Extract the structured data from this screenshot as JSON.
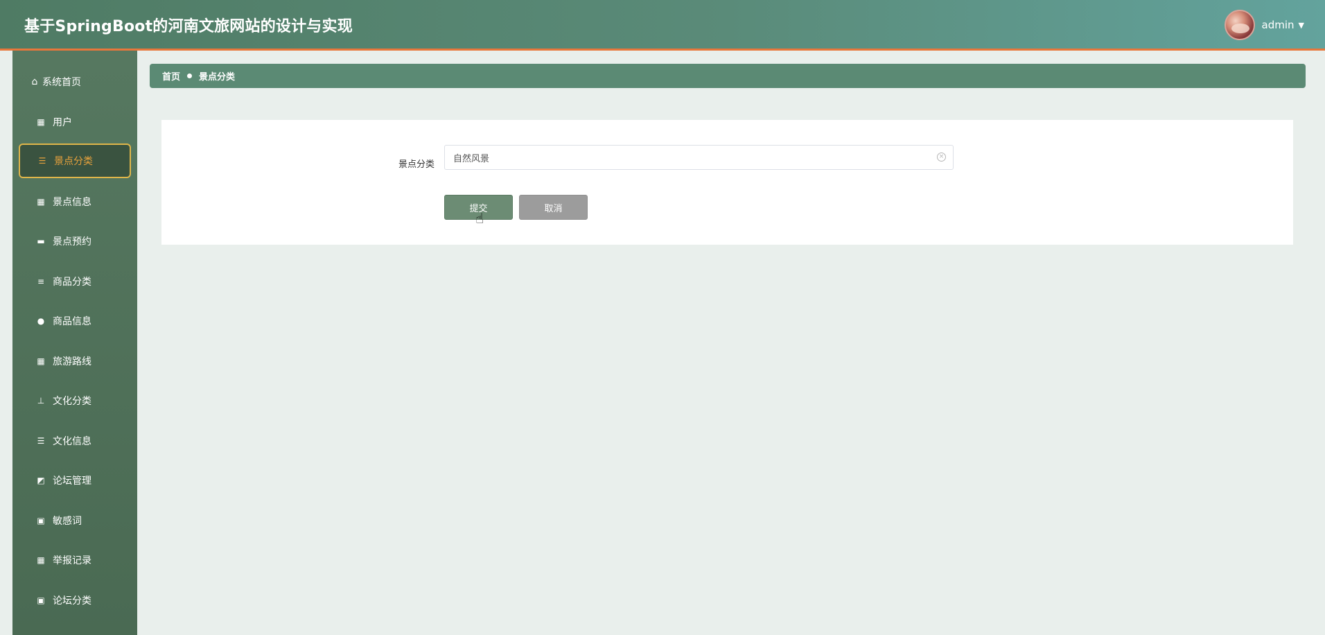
{
  "header": {
    "title": "基于SpringBoot的河南文旅网站的设计与实现",
    "username": "admin"
  },
  "sidebar": {
    "items": [
      {
        "label": "系统首页",
        "icon": "home-icon"
      },
      {
        "label": "用户",
        "icon": "grid-icon"
      },
      {
        "label": "景点分类",
        "icon": "list-icon",
        "active": true
      },
      {
        "label": "景点信息",
        "icon": "grid-icon"
      },
      {
        "label": "景点预约",
        "icon": "briefcase-icon"
      },
      {
        "label": "商品分类",
        "icon": "sliders-icon"
      },
      {
        "label": "商品信息",
        "icon": "user-icon"
      },
      {
        "label": "旅游路线",
        "icon": "grid-icon"
      },
      {
        "label": "文化分类",
        "icon": "stamp-icon"
      },
      {
        "label": "文化信息",
        "icon": "list-icon"
      },
      {
        "label": "论坛管理",
        "icon": "chart-icon"
      },
      {
        "label": "敏感词",
        "icon": "clipboard-icon"
      },
      {
        "label": "举报记录",
        "icon": "grid-icon"
      },
      {
        "label": "论坛分类",
        "icon": "clipboard-icon"
      }
    ]
  },
  "breadcrumb": {
    "home": "首页",
    "current": "景点分类"
  },
  "form": {
    "label": "景点分类",
    "value": "自然风景",
    "submit_label": "提交",
    "cancel_label": "取消"
  },
  "colors": {
    "accent": "#e8a23c",
    "sidebar": "#4f7059",
    "header": "#5a8b79",
    "header_border": "#e8773b"
  }
}
